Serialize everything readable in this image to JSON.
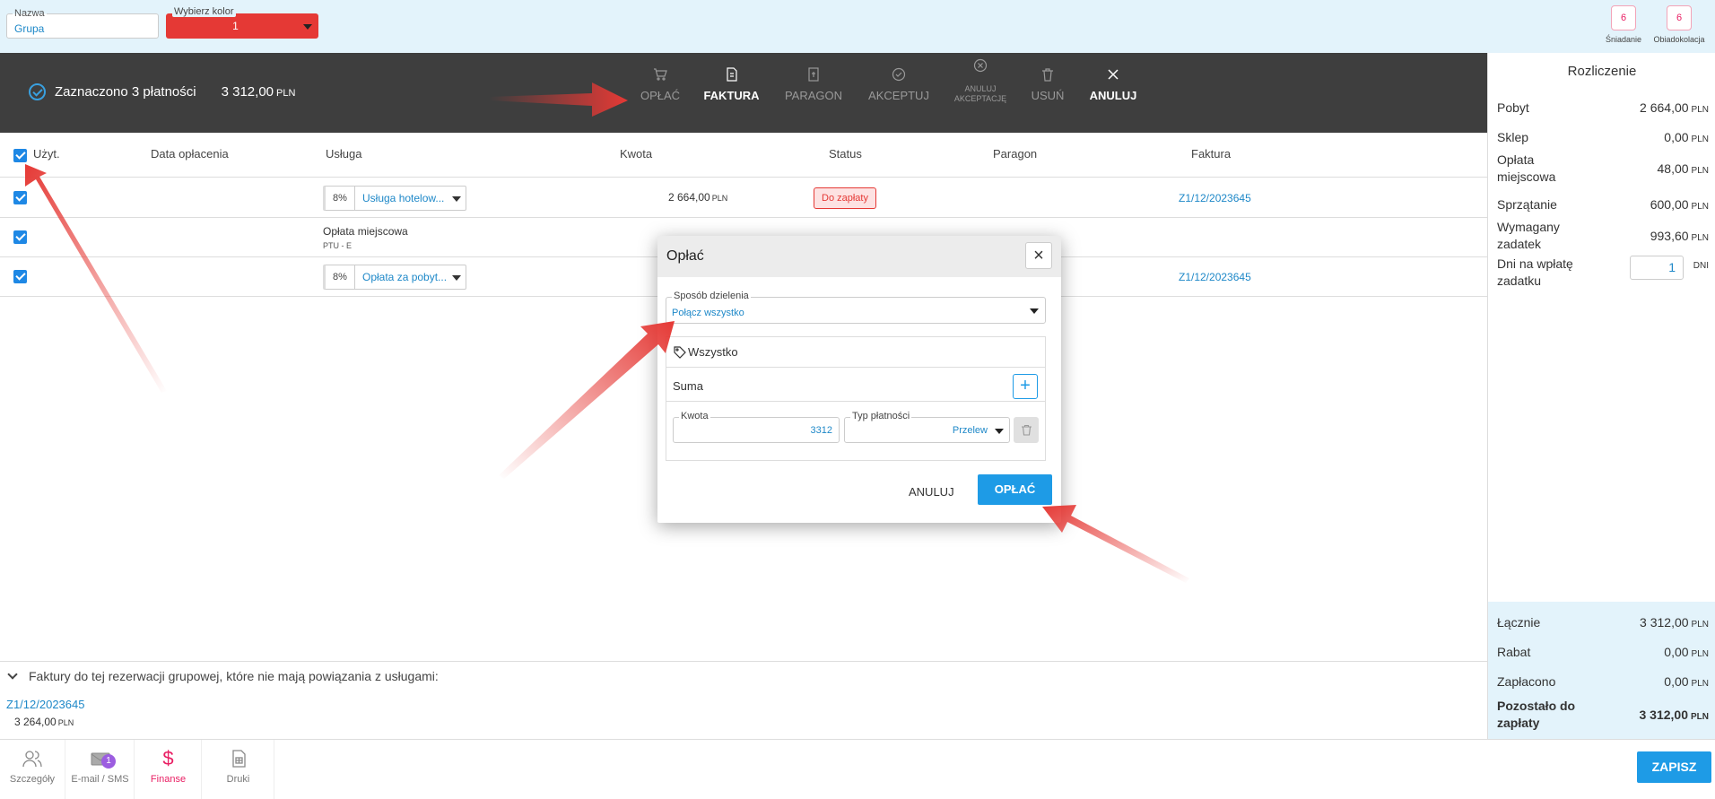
{
  "topbar": {
    "name_label": "Nazwa",
    "name_value": "Grupa",
    "color_label": "Wybierz kolor",
    "color_value": "1",
    "color_hex": "#e53935",
    "meals": [
      {
        "count": "6",
        "label": "Śniadanie"
      },
      {
        "count": "6",
        "label": "Obiadokolacja"
      }
    ]
  },
  "actionbar": {
    "selected_text": "Zaznaczono 3 płatności",
    "selected_amount": "3 312,00",
    "currency": "PLN",
    "actions": [
      {
        "label": "OPŁAĆ",
        "icon": "cart-icon"
      },
      {
        "label": "FAKTURA",
        "icon": "invoice-icon"
      },
      {
        "label": "PARAGON",
        "icon": "receipt-icon"
      },
      {
        "label": "AKCEPTUJ",
        "icon": "check-circle-icon"
      },
      {
        "label_line1": "ANULUJ",
        "label_line2": "AKCEPTACJĘ",
        "icon": "x-circle-icon"
      },
      {
        "label": "USUŃ",
        "icon": "trash-icon"
      },
      {
        "label": "ANULUJ",
        "icon": "close-icon"
      }
    ]
  },
  "table": {
    "headers": {
      "user": "Użyt.",
      "paid_date": "Data opłacenia",
      "service": "Usługa",
      "amount": "Kwota",
      "status": "Status",
      "receipt": "Paragon",
      "invoice": "Faktura"
    },
    "rows": [
      {
        "vat": "8%",
        "service": "Usługa hotelow...",
        "amount": "2 664,00",
        "currency": "PLN",
        "status": "Do zapłaty",
        "invoice": "Z1/12/2023645"
      },
      {
        "service": "Opłata miejscowa",
        "service_sub": "PTU - E"
      },
      {
        "vat": "8%",
        "service": "Opłata za pobyt...",
        "invoice": "Z1/12/2023645"
      }
    ]
  },
  "invoices_section": {
    "header": "Faktury do tej rezerwacji grupowej, które nie mają powiązania z usługami:",
    "invoice": "Z1/12/2023645",
    "amount": "3 264,00",
    "currency": "PLN"
  },
  "bottomnav": {
    "items": [
      {
        "label": "Szczegóły",
        "icon": "users-icon"
      },
      {
        "label": "E-mail / SMS",
        "icon": "mail-icon",
        "badge": "1"
      },
      {
        "label": "Finanse",
        "icon": "dollar-icon"
      },
      {
        "label": "Druki",
        "icon": "document-icon"
      }
    ],
    "save_label": "ZAPISZ"
  },
  "settlement": {
    "title": "Rozliczenie",
    "currency": "PLN",
    "rows": [
      {
        "label": "Pobyt",
        "value": "2 664,00"
      },
      {
        "label": "Sklep",
        "value": "0,00"
      },
      {
        "label_line1": "Opłata",
        "label_line2": "miejscowa",
        "value": "48,00"
      },
      {
        "label": "Sprzątanie",
        "value": "600,00"
      },
      {
        "label_line1": "Wymagany",
        "label_line2": "zadatek",
        "value": "993,60"
      }
    ],
    "deposit_days_label_line1": "Dni na wpłatę",
    "deposit_days_label_line2": "zadatku",
    "deposit_days_value": "1",
    "deposit_days_unit": "DNI",
    "summary": [
      {
        "label": "Łącznie",
        "value": "3 312,00"
      },
      {
        "label": "Rabat",
        "value": "0,00"
      },
      {
        "label": "Zapłacono",
        "value": "0,00"
      }
    ],
    "remaining_label_line1": "Pozostało do",
    "remaining_label_line2": "zapłaty",
    "remaining_value": "3 312,00"
  },
  "dialog": {
    "title": "Opłać",
    "split_label": "Sposób dzielenia",
    "split_value": "Połącz wszystko",
    "group_label": "Wszystko",
    "sum_label": "Suma",
    "amount_label": "Kwota",
    "amount_value": "3312",
    "payment_type_label": "Typ płatności",
    "payment_type_value": "Przelew",
    "cancel_label": "ANULUJ",
    "pay_label": "OPŁAĆ"
  },
  "colors": {
    "accent": "#1e9be6",
    "danger": "#e53935",
    "dark_bar": "#3e3e3e",
    "light_bg": "#e3f3fb",
    "pink": "#e91e63"
  }
}
